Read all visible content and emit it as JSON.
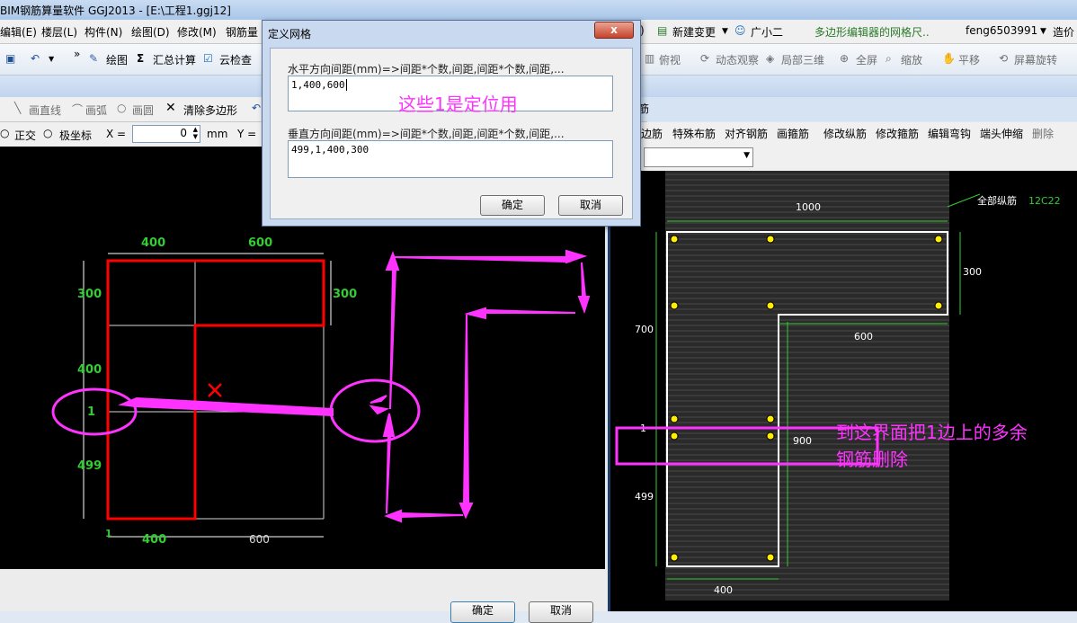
{
  "window": {
    "title": "BIM钢筋算量软件 GGJ2013 - [E:\\工程1.ggj12]"
  },
  "menubar": {
    "items": [
      "编辑(E)",
      "楼层(L)",
      "构件(N)",
      "绘图(D)",
      "修改(M)",
      "钢筋量"
    ],
    "right_items": [
      ")",
      "新建变更",
      "广小二",
      "多边形编辑器的网格尺..",
      "feng6503991",
      "造价"
    ]
  },
  "toolbar1": {
    "left": [
      "绘图",
      "汇总计算",
      "云检查"
    ],
    "right": [
      "俯视",
      "动态观察",
      "局部三维",
      "全屏",
      "缩放",
      "平移",
      "屏幕旋转"
    ]
  },
  "toolbar2": {
    "items": [
      "画直线",
      "画弧",
      "画圆",
      "清除多边形"
    ]
  },
  "toolbar3": {
    "ortho": "正交",
    "polar": "极坐标",
    "x_label": "X =",
    "x_value": "0",
    "unit": "mm",
    "y_label": "Y ="
  },
  "right_toolbar": {
    "tab": "筋",
    "items": [
      "边筋",
      "特殊布筋",
      "对齐钢筋",
      "画箍筋",
      "修改纵筋",
      "修改箍筋",
      "编辑弯钩",
      "端头伸缩",
      "删除"
    ]
  },
  "dialog": {
    "title": "定义网格",
    "close": "x",
    "h_label": "水平方向间距(mm)=>间距*个数,间距,间距*个数,间距,...",
    "h_value": "1,400,600",
    "v_label": "垂直方向间距(mm)=>间距*个数,间距,间距*个数,间距,...",
    "v_value": "499,1,400,300",
    "ok": "确定",
    "cancel": "取消",
    "annotation": "这些1是定位用"
  },
  "left_drawing": {
    "top_dims": [
      "400",
      "600"
    ],
    "left_dims": [
      "300",
      "400",
      "1",
      "499"
    ],
    "right_dim": "300",
    "bottom_dims": [
      "400",
      "600"
    ],
    "bottom_one": "1"
  },
  "right_drawing": {
    "longitudinal_label": "全部纵筋",
    "longitudinal_value": "12C22",
    "dims": {
      "top": "1000",
      "right": "300",
      "left_upper": "700",
      "step": "600",
      "mid": "900",
      "left_lower": "499",
      "bottom": "400",
      "one": "1"
    },
    "annotation_line1": "到这界面把1边上的多余",
    "annotation_line2": "钢筋删除"
  },
  "bottom": {
    "ok": "确定",
    "cancel": "取消"
  },
  "colors": {
    "accent": "#ff33ff",
    "dim_green": "#33cc33",
    "polygon_red": "#ff0000"
  }
}
